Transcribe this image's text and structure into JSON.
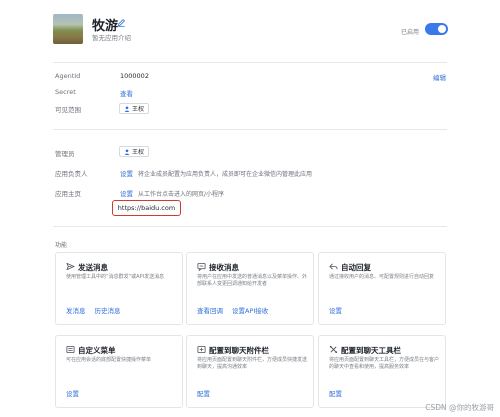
{
  "app": {
    "name": "牧游",
    "description": "暂无应用介绍",
    "status_label": "已启用",
    "enabled": true
  },
  "basic": {
    "agentid_label": "AgentId",
    "agentid_value": "1000002",
    "edit_label": "编辑",
    "secret_label": "Secret",
    "secret_action": "查看",
    "scope_label": "可见范围",
    "scope_person": "王权"
  },
  "admin": {
    "manager_label": "管理员",
    "manager_person": "王权",
    "owner_label": "应用负责人",
    "owner_action": "设置",
    "owner_hint": "将企业成员配置为应用负责人，成员即可在企业微信内管理此应用",
    "homepage_label": "应用主页",
    "homepage_action": "设置",
    "homepage_hint": "从工作台点击进入的网页/小程序",
    "homepage_url": "https://baidu.com"
  },
  "features": {
    "section_title": "功能",
    "cards": [
      {
        "title": "发送消息",
        "icon": "send-icon",
        "desc": "使用管理工具中的“消息群发”或API发送消息",
        "links": [
          "发消息",
          "历史消息"
        ]
      },
      {
        "title": "接收消息",
        "icon": "message-icon",
        "desc": "将用户在应用中发送的普通消息以及菜单操作、外部联系人变更回调通知给开发者",
        "links": [
          "查看回调",
          "设置API接收"
        ]
      },
      {
        "title": "自动回复",
        "icon": "reply-icon",
        "desc": "通过接收用户的消息、可配置规则进行自动回复",
        "links": [
          "设置"
        ]
      },
      {
        "title": "自定义菜单",
        "icon": "menu-icon",
        "desc": "可在应用会话的底部配置快捷操作菜单",
        "links": [
          "设置"
        ]
      },
      {
        "title": "配置到聊天附件栏",
        "icon": "attachment-icon",
        "desc": "将应用页面配置到聊天附件栏，方便成员快捷发送到聊天，提高沟通效率",
        "links": [
          "配置"
        ]
      },
      {
        "title": "配置到聊天工具栏",
        "icon": "toolbar-icon",
        "desc": "将应用页面配置到聊天工具栏，方便成员在与客户的聊天中查看和使用，提高服务效率",
        "links": [
          "配置"
        ]
      }
    ]
  },
  "watermark": "CSDN @你的牧游哥",
  "colors": {
    "accent": "#2f6fd8",
    "toggle": "#3a79ec",
    "highlight_border": "#d23a2e"
  }
}
